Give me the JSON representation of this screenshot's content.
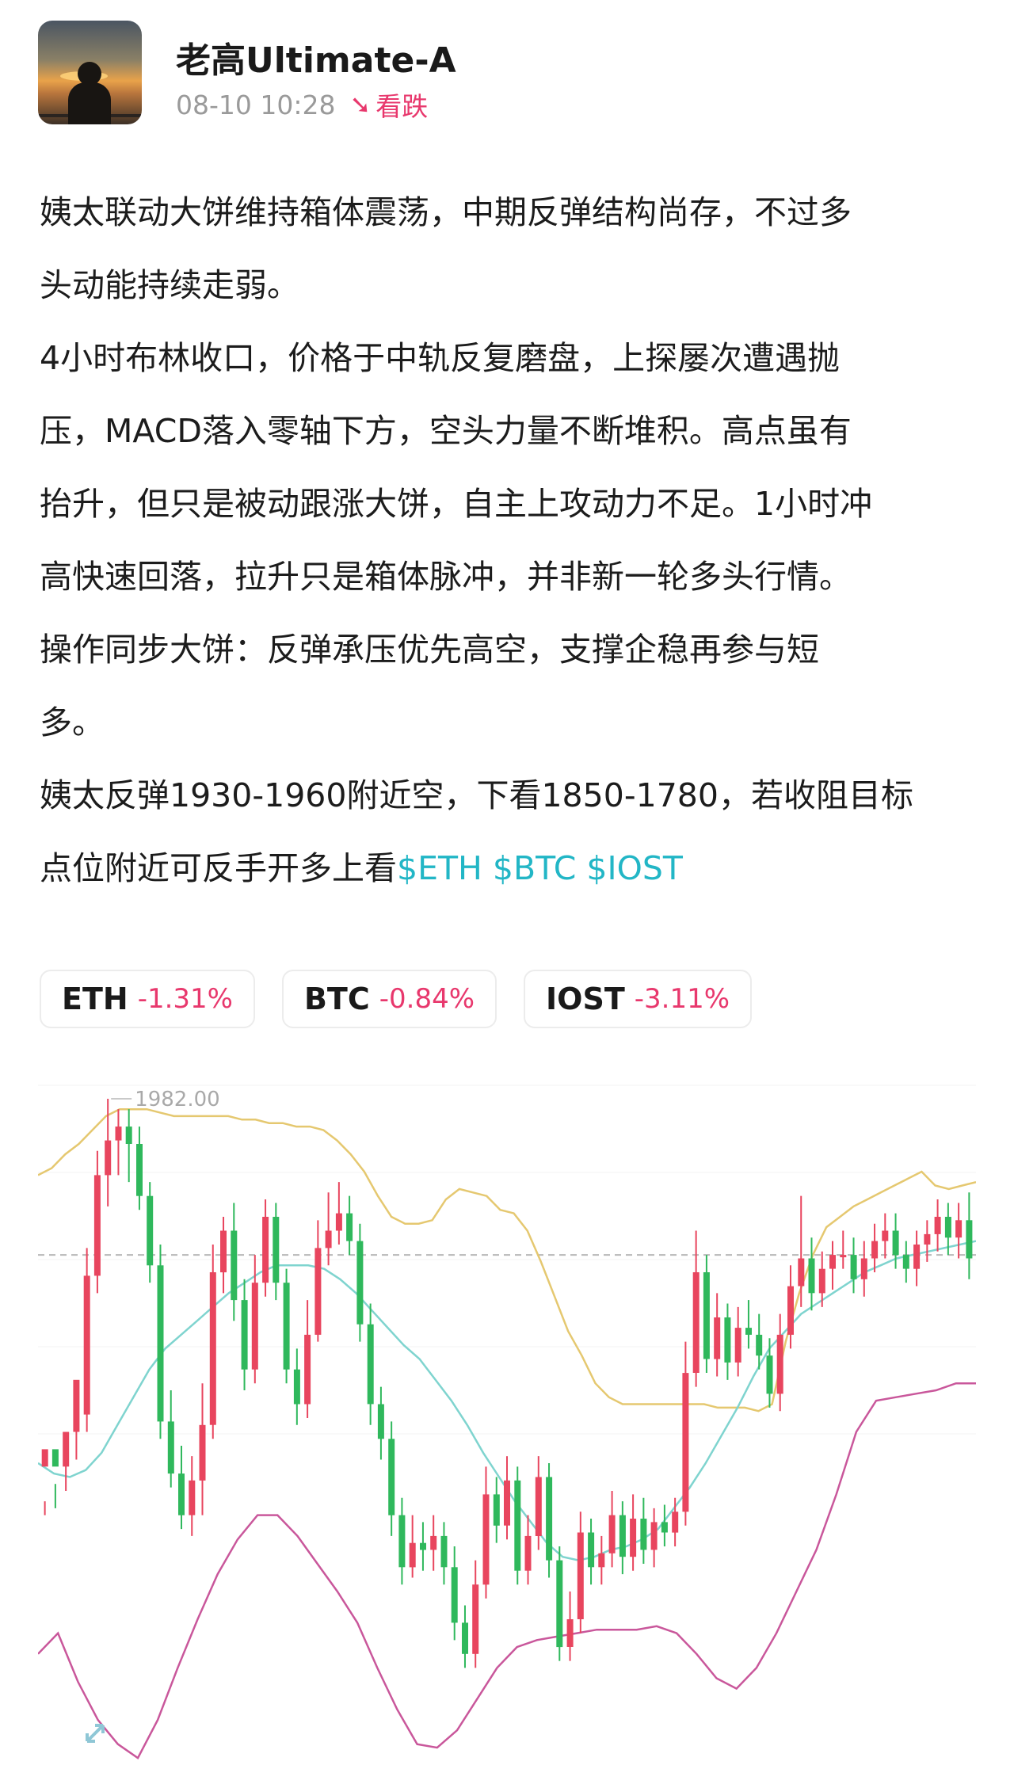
{
  "post": {
    "author": "老高Ultimate-A",
    "datetime": "08-10 10:28",
    "sentiment_icon": "down-arrow-icon",
    "sentiment": "看跌",
    "paragraphs": [
      "姨太联动大饼维持箱体震荡，中期反弹结构尚存，不过多\n头动能持续走弱。",
      "",
      "4小时布林收口，价格于中轨反复磨盘，上探屡次遭遇抛\n压，MACD落入零轴下方，空头力量不断堆积。高点虽有\n抬升，但只是被动跟涨大饼，自主上攻动力不足。1小时冲\n高快速回落，拉升只是箱体脉冲，并非新一轮多头行情。\n操作同步大饼：反弹承压优先高空，支撑企稳再参与短\n多。",
      "姨太反弹1930-1960附近空，下看1850-1780，若收阻目标\n点位附近可反手开多上看"
    ],
    "tags": "$ETH $BTC $IOST"
  },
  "tickers": [
    {
      "symbol": "ETH",
      "change": "-1.31%"
    },
    {
      "symbol": "BTC",
      "change": "-0.84%"
    },
    {
      "symbol": "IOST",
      "change": "-3.11%"
    }
  ],
  "colors": {
    "bearish": "#e8386d",
    "tag": "#22b6c6",
    "candle_up": "#e8455e",
    "candle_down": "#2fb85c",
    "bb_upper": "#e5c870",
    "bb_middle": "#7fd4cf",
    "bb_lower": "#c9579b"
  },
  "chart_data": {
    "type": "candlestick",
    "high_label": "1982.00",
    "ref_price": 1937,
    "ylim": [
      1790,
      1990
    ],
    "candles": [
      [
        1876,
        1881,
        1866,
        1862
      ],
      [
        1881,
        1876,
        1864,
        1871
      ],
      [
        1876,
        1886,
        1879,
        1869
      ],
      [
        1886,
        1901,
        1893,
        1878
      ],
      [
        1891,
        1931,
        1939,
        1886
      ],
      [
        1931,
        1960,
        1967,
        1926
      ],
      [
        1960,
        1970,
        1982,
        1951
      ],
      [
        1970,
        1974,
        1979,
        1960
      ],
      [
        1974,
        1969,
        1979,
        1958
      ],
      [
        1969,
        1954,
        1974,
        1950
      ],
      [
        1954,
        1934,
        1958,
        1929
      ],
      [
        1934,
        1889,
        1940,
        1884
      ],
      [
        1889,
        1874,
        1898,
        1870
      ],
      [
        1874,
        1862,
        1882,
        1858
      ],
      [
        1862,
        1872,
        1879,
        1856
      ],
      [
        1872,
        1888,
        1900,
        1862
      ],
      [
        1888,
        1932,
        1940,
        1884
      ],
      [
        1932,
        1944,
        1948,
        1926
      ],
      [
        1944,
        1924,
        1952,
        1918
      ],
      [
        1924,
        1904,
        1930,
        1898
      ],
      [
        1904,
        1929,
        1937,
        1900
      ],
      [
        1929,
        1948,
        1953,
        1925
      ],
      [
        1948,
        1929,
        1952,
        1924
      ],
      [
        1929,
        1904,
        1933,
        1900
      ],
      [
        1904,
        1894,
        1910,
        1888
      ],
      [
        1894,
        1914,
        1924,
        1890
      ],
      [
        1914,
        1939,
        1947,
        1912
      ],
      [
        1939,
        1944,
        1955,
        1934
      ],
      [
        1944,
        1949,
        1958,
        1940
      ],
      [
        1949,
        1941,
        1954,
        1937
      ],
      [
        1941,
        1917,
        1946,
        1912
      ],
      [
        1917,
        1894,
        1923,
        1888
      ],
      [
        1894,
        1884,
        1899,
        1878
      ],
      [
        1884,
        1862,
        1889,
        1856
      ],
      [
        1862,
        1847,
        1867,
        1842
      ],
      [
        1847,
        1854,
        1862,
        1844
      ],
      [
        1854,
        1852,
        1860,
        1846
      ],
      [
        1852,
        1856,
        1862,
        1846
      ],
      [
        1856,
        1847,
        1860,
        1842
      ],
      [
        1847,
        1831,
        1853,
        1826
      ],
      [
        1831,
        1822,
        1836,
        1818
      ],
      [
        1822,
        1842,
        1849,
        1818
      ],
      [
        1842,
        1868,
        1876,
        1838
      ],
      [
        1868,
        1859,
        1873,
        1854
      ],
      [
        1859,
        1872,
        1879,
        1855
      ],
      [
        1872,
        1846,
        1876,
        1842
      ],
      [
        1846,
        1856,
        1862,
        1842
      ],
      [
        1856,
        1873,
        1879,
        1852
      ],
      [
        1873,
        1849,
        1877,
        1844
      ],
      [
        1849,
        1824,
        1853,
        1820
      ],
      [
        1824,
        1832,
        1840,
        1820
      ],
      [
        1832,
        1857,
        1863,
        1828
      ],
      [
        1857,
        1847,
        1861,
        1842
      ],
      [
        1847,
        1851,
        1856,
        1842
      ],
      [
        1851,
        1862,
        1869,
        1847
      ],
      [
        1862,
        1850,
        1866,
        1845
      ],
      [
        1850,
        1861,
        1868,
        1846
      ],
      [
        1861,
        1852,
        1867,
        1848
      ],
      [
        1852,
        1860,
        1864,
        1847
      ],
      [
        1860,
        1857,
        1865,
        1853
      ],
      [
        1857,
        1863,
        1867,
        1853
      ],
      [
        1863,
        1903,
        1912,
        1859
      ],
      [
        1903,
        1932,
        1944,
        1899
      ],
      [
        1932,
        1907,
        1937,
        1903
      ],
      [
        1907,
        1919,
        1926,
        1902
      ],
      [
        1919,
        1906,
        1923,
        1901
      ],
      [
        1906,
        1916,
        1922,
        1902
      ],
      [
        1916,
        1914,
        1924,
        1910
      ],
      [
        1914,
        1908,
        1920,
        1904
      ],
      [
        1908,
        1897,
        1913,
        1893
      ],
      [
        1897,
        1914,
        1920,
        1892
      ],
      [
        1914,
        1928,
        1934,
        1910
      ],
      [
        1928,
        1936,
        1954,
        1922
      ],
      [
        1936,
        1926,
        1942,
        1921
      ],
      [
        1926,
        1933,
        1938,
        1922
      ],
      [
        1933,
        1937,
        1941,
        1927
      ],
      [
        1937,
        1937,
        1944,
        1933
      ],
      [
        1937,
        1930,
        1942,
        1926
      ],
      [
        1930,
        1936,
        1941,
        1925
      ],
      [
        1936,
        1941,
        1946,
        1932
      ],
      [
        1941,
        1944,
        1949,
        1936
      ],
      [
        1944,
        1937,
        1949,
        1933
      ],
      [
        1937,
        1933,
        1941,
        1929
      ],
      [
        1933,
        1940,
        1944,
        1928
      ],
      [
        1940,
        1943,
        1947,
        1935
      ],
      [
        1943,
        1948,
        1953,
        1938
      ],
      [
        1948,
        1942,
        1952,
        1937
      ],
      [
        1942,
        1947,
        1952,
        1936
      ],
      [
        1947,
        1936,
        1955,
        1930
      ]
    ],
    "bb_upper": [
      1960,
      1962,
      1966,
      1969,
      1973,
      1977,
      1979,
      1979,
      1979,
      1978,
      1977,
      1977,
      1977,
      1977,
      1977,
      1976,
      1976,
      1975,
      1975,
      1974,
      1974,
      1973,
      1970,
      1966,
      1961,
      1954,
      1948,
      1946,
      1946,
      1947,
      1953,
      1956,
      1955,
      1954,
      1950,
      1949,
      1944,
      1935,
      1925,
      1915,
      1908,
      1900,
      1896,
      1894,
      1894,
      1894,
      1894,
      1894,
      1894,
      1894,
      1893,
      1893,
      1893,
      1892,
      1894,
      1912,
      1926,
      1937,
      1945,
      1948,
      1951,
      1953,
      1955,
      1957,
      1959,
      1961,
      1957,
      1956,
      1957,
      1958
    ],
    "bb_middle": [
      1877,
      1874,
      1873,
      1875,
      1880,
      1888,
      1896,
      1904,
      1910,
      1914,
      1918,
      1922,
      1926,
      1929,
      1932,
      1934,
      1934,
      1934,
      1933,
      1930,
      1926,
      1921,
      1916,
      1911,
      1907,
      1901,
      1895,
      1888,
      1880,
      1873,
      1866,
      1860,
      1854,
      1850,
      1849,
      1850,
      1852,
      1853,
      1855,
      1858,
      1864,
      1870,
      1877,
      1885,
      1893,
      1902,
      1910,
      1915,
      1920,
      1923,
      1926,
      1929,
      1932,
      1934,
      1936,
      1937,
      1938,
      1939,
      1940,
      1941
    ],
    "bb_lower": [
      1822,
      1828,
      1814,
      1803,
      1796,
      1792,
      1803,
      1818,
      1832,
      1845,
      1855,
      1862,
      1862,
      1856,
      1848,
      1840,
      1831,
      1818,
      1806,
      1796,
      1795,
      1800,
      1809,
      1818,
      1824,
      1826,
      1827,
      1828,
      1829,
      1829,
      1829,
      1830,
      1828,
      1822,
      1815,
      1812,
      1818,
      1828,
      1840,
      1852,
      1868,
      1886,
      1895,
      1896,
      1897,
      1898,
      1900,
      1900
    ]
  }
}
